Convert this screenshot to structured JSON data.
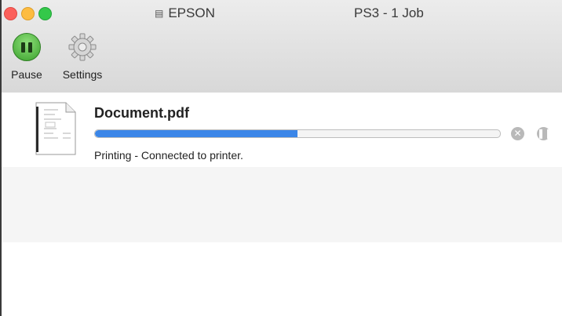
{
  "window": {
    "title_left": "EPSON",
    "title_right": "PS3 - 1 Job"
  },
  "toolbar": {
    "pause_label": "Pause",
    "settings_label": "Settings"
  },
  "job": {
    "document_name": "Document.pdf",
    "status": "Printing - Connected to printer.",
    "progress_percent": 50
  },
  "icons": {
    "printer_icon": "printer-icon",
    "pause_icon": "pause-icon",
    "settings_icon": "gear-icon",
    "document_icon": "document-thumbnail-icon",
    "cancel_icon": "cancel-circle-icon",
    "hold_icon": "pause-circle-icon"
  },
  "colors": {
    "progress": "#3b86e8",
    "pause_button": "#4caf3a",
    "close": "#fc605b",
    "minimize": "#fdbc40",
    "maximize": "#34c84a"
  }
}
